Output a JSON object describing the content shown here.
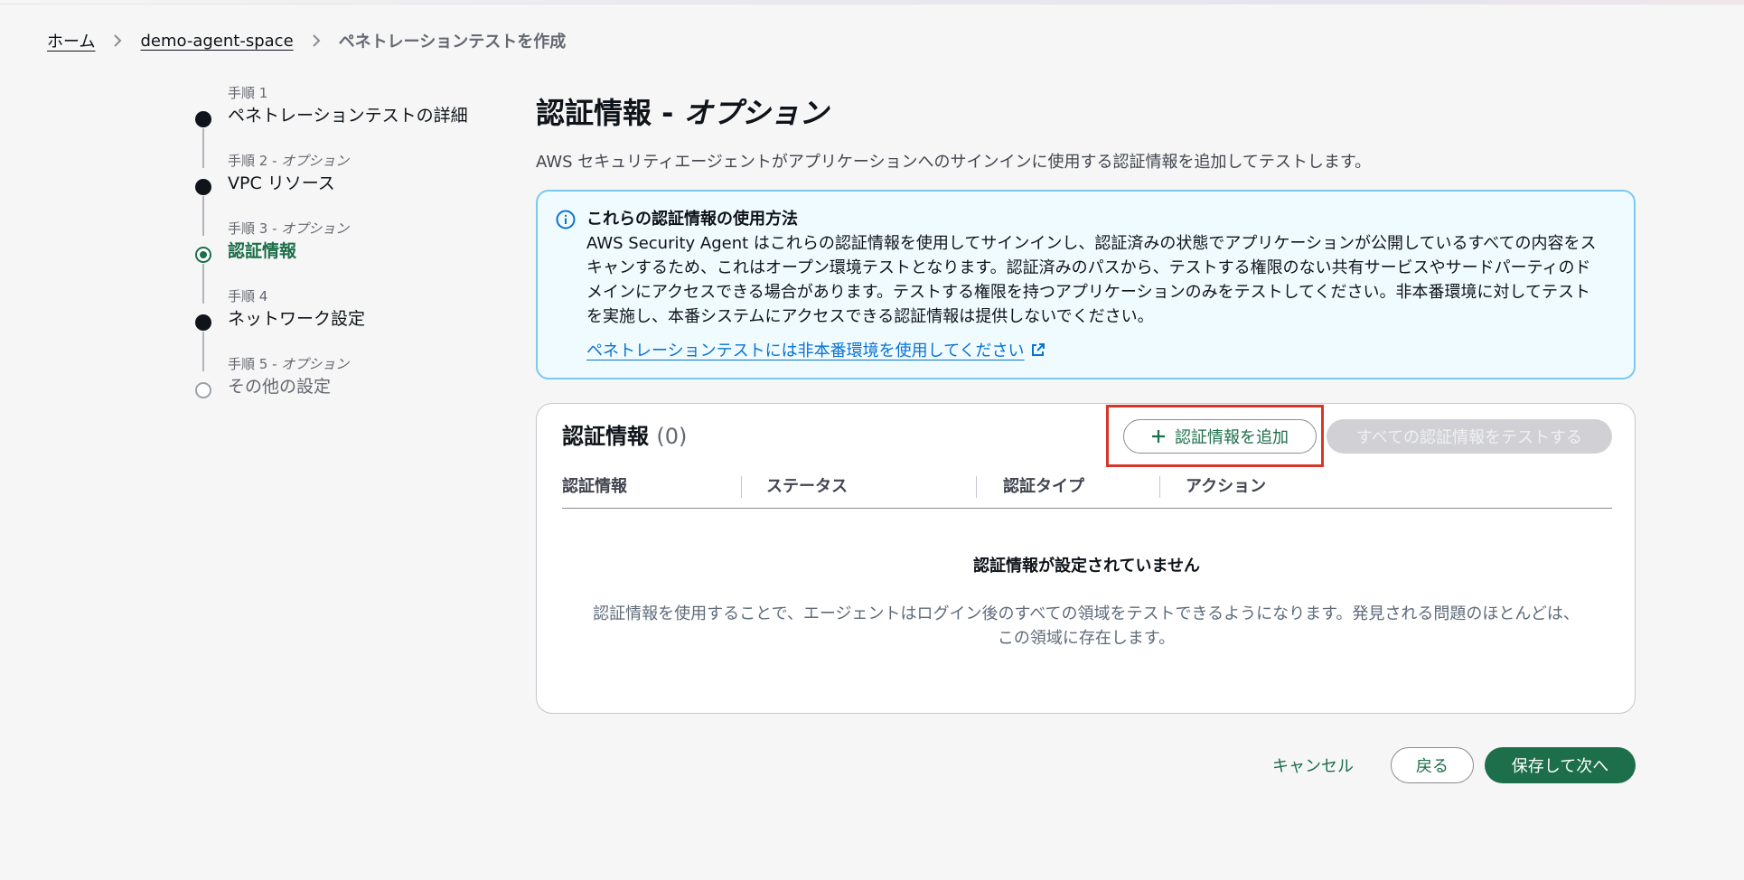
{
  "breadcrumb": {
    "items": [
      "ホーム",
      "demo-agent-space"
    ],
    "current": "ペネトレーションテストを作成"
  },
  "steps": [
    {
      "label": "手順 1",
      "optional": "",
      "title": "ペネトレーションテストの詳細",
      "state": "done"
    },
    {
      "label": "手順 2 - ",
      "optional": "オプション",
      "title": "VPC リソース",
      "state": "done"
    },
    {
      "label": "手順 3 - ",
      "optional": "オプション",
      "title": "認証情報",
      "state": "active"
    },
    {
      "label": "手順 4",
      "optional": "",
      "title": "ネットワーク設定",
      "state": "done"
    },
    {
      "label": "手順 5 - ",
      "optional": "オプション",
      "title": "その他の設定",
      "state": "future"
    }
  ],
  "page": {
    "title": "認証情報 - ",
    "title_optional": "オプション",
    "description": "AWS セキュリティエージェントがアプリケーションへのサインインに使用する認証情報を追加してテストします。"
  },
  "info": {
    "title": "これらの認証情報の使用方法",
    "body": "AWS Security Agent はこれらの認証情報を使用してサインインし、認証済みの状態でアプリケーションが公開しているすべての内容をスキャンするため、これはオープン環境テストとなります。認証済みのパスから、テストする権限のない共有サービスやサードパーティのドメインにアクセスできる場合があります。テストする権限を持つアプリケーションのみをテストしてください。非本番環境に対してテストを実施し、本番システムにアクセスできる認証情報は提供しないでください。",
    "link": "ペネトレーションテストには非本番環境を使用してください"
  },
  "credentials": {
    "header": "認証情報",
    "count": "(0)",
    "add_button": "認証情報を追加",
    "test_all_button": "すべての認証情報をテストする",
    "columns": [
      "認証情報",
      "ステータス",
      "認証タイプ",
      "アクション"
    ],
    "empty_title": "認証情報が設定されていません",
    "empty_desc": "認証情報を使用することで、エージェントはログイン後のすべての領域をテストできるようになります。発見される問題のほとんどは、この領域に存在します。"
  },
  "footer": {
    "cancel": "キャンセル",
    "back": "戻る",
    "next": "保存して次へ"
  },
  "colors": {
    "primary": "#1d6e4a",
    "link": "#0972d3",
    "info_bg": "#f0fbff",
    "info_border": "#7ac9ee",
    "highlight": "#d6372b"
  }
}
